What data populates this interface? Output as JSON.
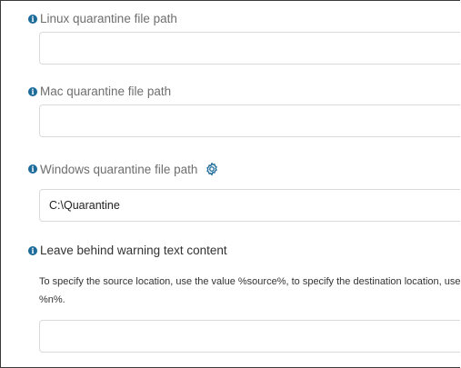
{
  "fields": {
    "linux": {
      "label": "Linux quarantine file path",
      "value": ""
    },
    "mac": {
      "label": "Mac quarantine file path",
      "value": ""
    },
    "windows": {
      "label": "Windows quarantine file path",
      "value": "C:\\Quarantine",
      "settings_icon": "gear-icon"
    },
    "leave_behind": {
      "label": "Leave behind warning text content",
      "help_line_1": "To specify the source location, use the value %source%, to specify the destination location, use",
      "help_line_2": "%n%.",
      "value": ""
    }
  },
  "icons": {
    "info": "info-icon",
    "info_glyph": "i"
  },
  "colors": {
    "info_icon": "#1d6b9a",
    "gear_icon": "#1d6b9a",
    "label": "#6e6e6e",
    "input_border": "#d9d9d9"
  }
}
